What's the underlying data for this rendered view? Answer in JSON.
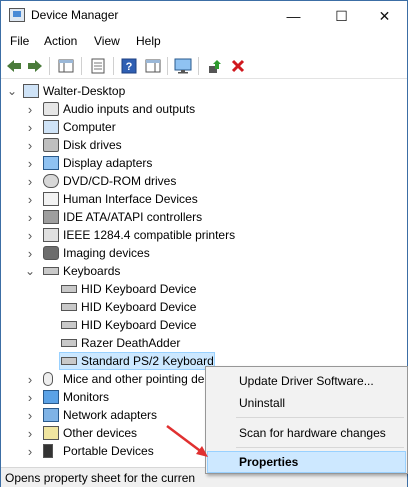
{
  "window": {
    "title": "Device Manager"
  },
  "controls": {
    "minimize": "—",
    "maximize": "☐",
    "close": "✕"
  },
  "menu": [
    "File",
    "Action",
    "View",
    "Help"
  ],
  "tree": {
    "root": "Walter-Desktop",
    "categories": [
      {
        "label": "Audio inputs and outputs",
        "icon": "speaker-icon"
      },
      {
        "label": "Computer",
        "icon": "computer-icon"
      },
      {
        "label": "Disk drives",
        "icon": "disk-drive-icon"
      },
      {
        "label": "Display adapters",
        "icon": "display-adapter-icon"
      },
      {
        "label": "DVD/CD-ROM drives",
        "icon": "dvd-drive-icon"
      },
      {
        "label": "Human Interface Devices",
        "icon": "hid-icon"
      },
      {
        "label": "IDE ATA/ATAPI controllers",
        "icon": "ide-controller-icon"
      },
      {
        "label": "IEEE 1284.4 compatible printers",
        "icon": "printer-icon"
      },
      {
        "label": "Imaging devices",
        "icon": "camera-icon"
      },
      {
        "label": "Keyboards",
        "icon": "keyboard-icon"
      }
    ],
    "keyboards": [
      "HID Keyboard Device",
      "HID Keyboard Device",
      "HID Keyboard Device",
      "Razer DeathAdder",
      "Standard PS/2 Keyboard"
    ],
    "after": [
      {
        "label": "Mice and other pointing de",
        "icon": "mouse-icon"
      },
      {
        "label": "Monitors",
        "icon": "monitor-icon"
      },
      {
        "label": "Network adapters",
        "icon": "network-adapter-icon"
      },
      {
        "label": "Other devices",
        "icon": "other-devices-icon"
      },
      {
        "label": "Portable Devices",
        "icon": "portable-device-icon"
      }
    ]
  },
  "context_menu": {
    "update": "Update Driver Software...",
    "uninstall": "Uninstall",
    "scan": "Scan for hardware changes",
    "properties": "Properties"
  },
  "status": "Opens property sheet for the curren",
  "colors": {
    "selection": "#cce8ff",
    "arrow": "#e03030"
  }
}
